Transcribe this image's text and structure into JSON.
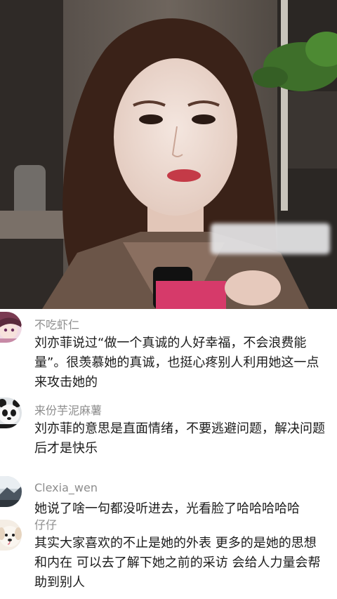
{
  "comments": [
    {
      "username": "不吃虾仁",
      "avatar_icon": "anime-girl-avatar-icon",
      "text": "刘亦菲说过“做一个真诚的人好幸福，不会浪费能量”。很羡慕她的真诚，也挺心疼别人利用她这一点来攻击她的"
    },
    {
      "username": "来份芋泥麻薯",
      "avatar_icon": "panda-avatar-icon",
      "text": "刘亦菲的意思是直面情绪，不要逃避问题，解决问题后才是快乐"
    },
    {
      "username": "Clexia_wen",
      "avatar_icon": "landscape-avatar-icon",
      "text": "她说了啥一句都没听进去，光看脸了哈哈哈哈哈"
    },
    {
      "username": "仔仔",
      "avatar_icon": "puppy-avatar-icon",
      "text": "其实大家喜欢的不止是她的外表 更多的是她的思想和内在 可以去了解下她之前的采访 会给人力量会帮助到别人"
    }
  ],
  "colors": {
    "username": "#8d8d8d",
    "comment_text": "#1b1b1b",
    "background": "#ffffff"
  }
}
